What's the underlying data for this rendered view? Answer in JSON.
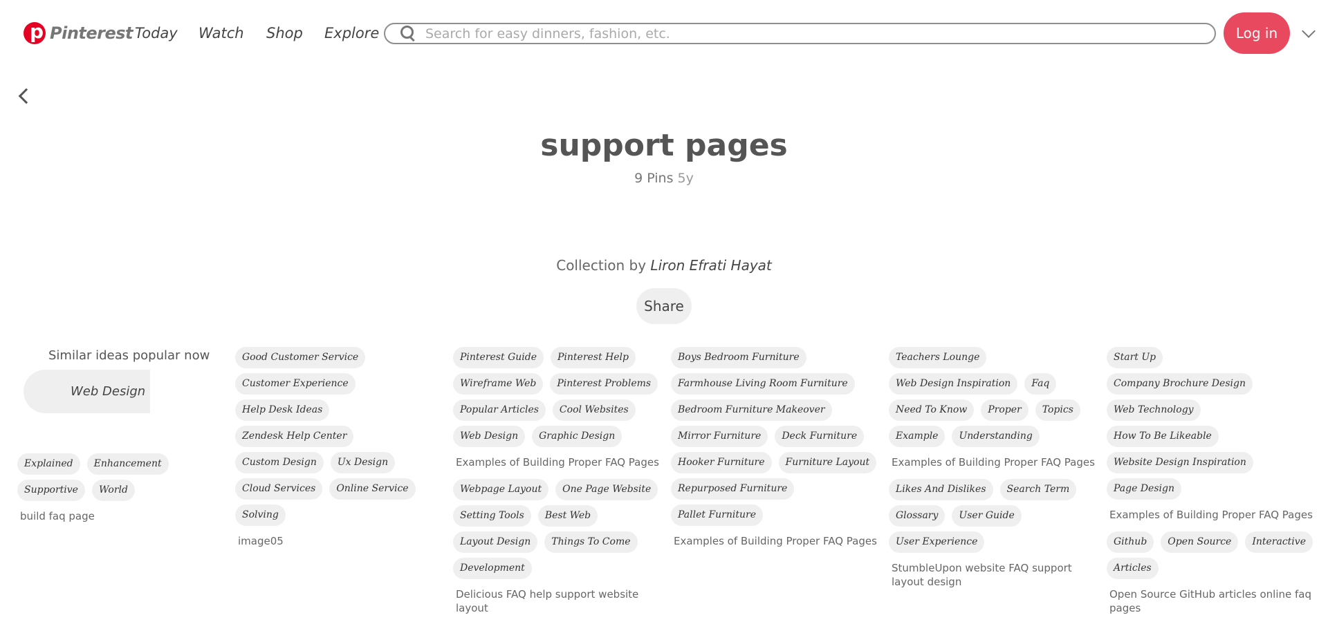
{
  "header": {
    "brand": "Pinterest",
    "nav": [
      "Today",
      "Watch",
      "Shop",
      "Explore"
    ],
    "search_placeholder": "Search for easy dinners, fashion, etc.",
    "login_label": "Log in"
  },
  "board": {
    "title": "support pages",
    "pins": "9 Pins",
    "age": "5y",
    "collection_prefix": "Collection by",
    "author": "Liron Efrati Hayat",
    "share_label": "Share"
  },
  "similar": {
    "title": "Similar ideas popular now",
    "button": "Web Design"
  },
  "columns": [
    {
      "groups": [
        {
          "tags": [
            "Explained",
            "Enhancement",
            "Supportive",
            "World"
          ],
          "caption": "build faq page"
        }
      ]
    },
    {
      "groups": [
        {
          "tags": [
            "Good Customer Service",
            "Customer Experience",
            "Help Desk Ideas",
            "Zendesk Help Center",
            "Custom Design",
            "Ux Design",
            "Cloud Services",
            "Online Service",
            "Solving"
          ],
          "caption": "image05"
        }
      ]
    },
    {
      "groups": [
        {
          "tags": [
            "Pinterest Guide",
            "Pinterest Help",
            "Wireframe Web",
            "Pinterest Problems",
            "Popular Articles",
            "Cool Websites",
            "Web Design",
            "Graphic Design"
          ],
          "caption": "Examples of Building Proper FAQ Pages"
        },
        {
          "tags": [
            "Webpage Layout",
            "One Page Website",
            "Setting Tools",
            "Best Web",
            "Layout Design",
            "Things To Come",
            "Development"
          ],
          "caption": "Delicious FAQ help support website layout"
        }
      ]
    },
    {
      "groups": [
        {
          "tags": [
            "Boys Bedroom Furniture",
            "Farmhouse Living Room Furniture",
            "Bedroom Furniture Makeover",
            "Mirror Furniture",
            "Deck Furniture",
            "Hooker Furniture",
            "Furniture Layout",
            "Repurposed Furniture",
            "Pallet Furniture"
          ],
          "caption": "Examples of Building Proper FAQ Pages"
        }
      ]
    },
    {
      "groups": [
        {
          "tags": [
            "Teachers Lounge",
            "Web Design Inspiration",
            "Faq",
            "Need To Know",
            "Proper",
            "Topics",
            "Example",
            "Understanding"
          ],
          "caption": "Examples of Building Proper FAQ Pages"
        },
        {
          "tags": [
            "Likes And Dislikes",
            "Search Term",
            "Glossary",
            "User Guide",
            "User Experience"
          ],
          "caption": "StumbleUpon website FAQ support layout design"
        }
      ]
    },
    {
      "groups": [
        {
          "tags": [
            "Start Up",
            "Company Brochure Design",
            "Web Technology",
            "How To Be Likeable",
            "Website Design Inspiration",
            "Page Design"
          ],
          "caption": "Examples of Building Proper FAQ Pages"
        },
        {
          "tags": [
            "Github",
            "Open Source",
            "Interactive",
            "Articles"
          ],
          "caption": "Open Source GitHub articles online faq pages"
        }
      ]
    }
  ]
}
